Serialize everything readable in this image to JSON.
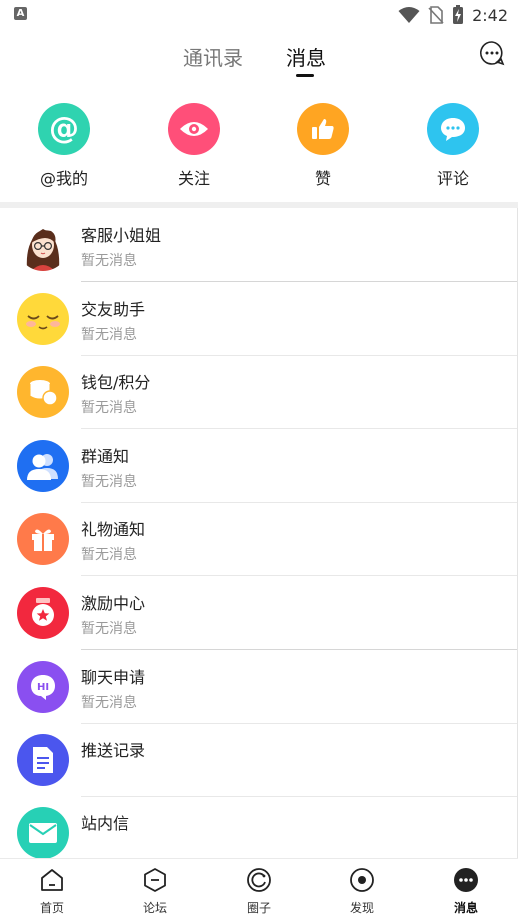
{
  "status_bar": {
    "notification_glyph": "A",
    "time": "2:42"
  },
  "top_tabs": {
    "contacts": "通讯录",
    "messages": "消息",
    "active": "消息"
  },
  "quick_actions": [
    {
      "label": "@我的",
      "icon": "at-icon",
      "color": "#2fd3b0"
    },
    {
      "label": "关注",
      "icon": "eye-icon",
      "color": "#ff4f79"
    },
    {
      "label": "赞",
      "icon": "thumbs-up-icon",
      "color": "#ffa522"
    },
    {
      "label": "评论",
      "icon": "comment-icon",
      "color": "#2ec4ef"
    }
  ],
  "messages": [
    {
      "name": "客服小姐姐",
      "preview": "暂无消息",
      "icon": "customer-service-avatar"
    },
    {
      "name": "交友助手",
      "preview": "暂无消息",
      "icon": "smiley-face-icon",
      "color": "#ffd93a"
    },
    {
      "name": "钱包/积分",
      "preview": "暂无消息",
      "icon": "coins-icon",
      "color": "#ffb62e"
    },
    {
      "name": "群通知",
      "preview": "暂无消息",
      "icon": "group-icon",
      "color": "#1f6ff2"
    },
    {
      "name": "礼物通知",
      "preview": "暂无消息",
      "icon": "gift-icon",
      "color": "#ff7a4a"
    },
    {
      "name": "激励中心",
      "preview": "暂无消息",
      "icon": "medal-icon",
      "color": "#f2283e"
    },
    {
      "name": "聊天申请",
      "preview": "暂无消息",
      "icon": "hi-chat-icon",
      "color": "#8a4ff0"
    },
    {
      "name": "推送记录",
      "preview": "",
      "icon": "document-icon",
      "color": "#4b56ee"
    },
    {
      "name": "站内信",
      "preview": "",
      "icon": "mail-icon",
      "color": "#27d0b5"
    }
  ],
  "bottom_nav": [
    {
      "label": "首页",
      "icon": "home-icon"
    },
    {
      "label": "论坛",
      "icon": "forum-icon"
    },
    {
      "label": "圈子",
      "icon": "circle-icon"
    },
    {
      "label": "发现",
      "icon": "discover-icon"
    },
    {
      "label": "消息",
      "icon": "message-icon",
      "active": true
    }
  ]
}
